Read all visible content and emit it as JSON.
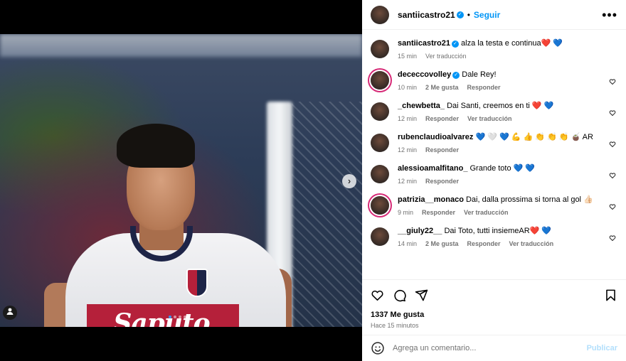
{
  "post": {
    "author": "santiicastro21",
    "follow_label": "Seguir",
    "separator": "•",
    "caption": "alza la testa e continua❤️ 💙",
    "caption_time": "15 min",
    "caption_translate": "Ver traducción",
    "likes": "1337 Me gusta",
    "posted_ago": "Hace 15 minutos",
    "image": {
      "sponsor_text": "Saputo",
      "carousel_count": 4,
      "carousel_active": 1
    }
  },
  "comments": [
    {
      "user": "dececcovolley",
      "verified": true,
      "text": "Dale Rey!",
      "time": "10 min",
      "likes": "2 Me gusta",
      "reply": "Responder",
      "translate": "",
      "ring": true
    },
    {
      "user": "_chewbetta_",
      "verified": false,
      "text": "Dai Santi, creemos en ti ❤️ 💙",
      "time": "12 min",
      "likes": "",
      "reply": "Responder",
      "translate": "Ver traducción",
      "ring": false
    },
    {
      "user": "rubenclaudioalvarez",
      "verified": false,
      "text": "💙 🤍 💙 💪 👍 👏 👏 👏 🧉 AR",
      "time": "12 min",
      "likes": "",
      "reply": "Responder",
      "translate": "",
      "ring": false
    },
    {
      "user": "alessioamalfitano_",
      "verified": false,
      "text": "Grande toto 💙 💙",
      "time": "12 min",
      "likes": "",
      "reply": "Responder",
      "translate": "",
      "ring": false
    },
    {
      "user": "patrizia__monaco",
      "verified": false,
      "text": "Dai, dalla prossima si torna al gol 👍🏻",
      "time": "9 min",
      "likes": "",
      "reply": "Responder",
      "translate": "Ver traducción",
      "ring": true
    },
    {
      "user": "__giuly22__",
      "verified": false,
      "text": "Dai Toto, tutti insiemeAR❤️ 💙",
      "time": "14 min",
      "likes": "2 Me gusta",
      "reply": "Responder",
      "translate": "Ver traducción",
      "ring": false
    }
  ],
  "composer": {
    "placeholder": "Agrega un comentario...",
    "post_label": "Publicar"
  },
  "icons": {
    "more": "more-options-icon",
    "like": "heart-icon",
    "comment": "comment-icon",
    "share": "share-icon",
    "save": "bookmark-icon",
    "emoji": "emoji-icon",
    "next": "chevron-right-icon"
  },
  "colors": {
    "accent": "#0095f6",
    "muted": "#737373",
    "post_disabled": "#b2dffc"
  }
}
